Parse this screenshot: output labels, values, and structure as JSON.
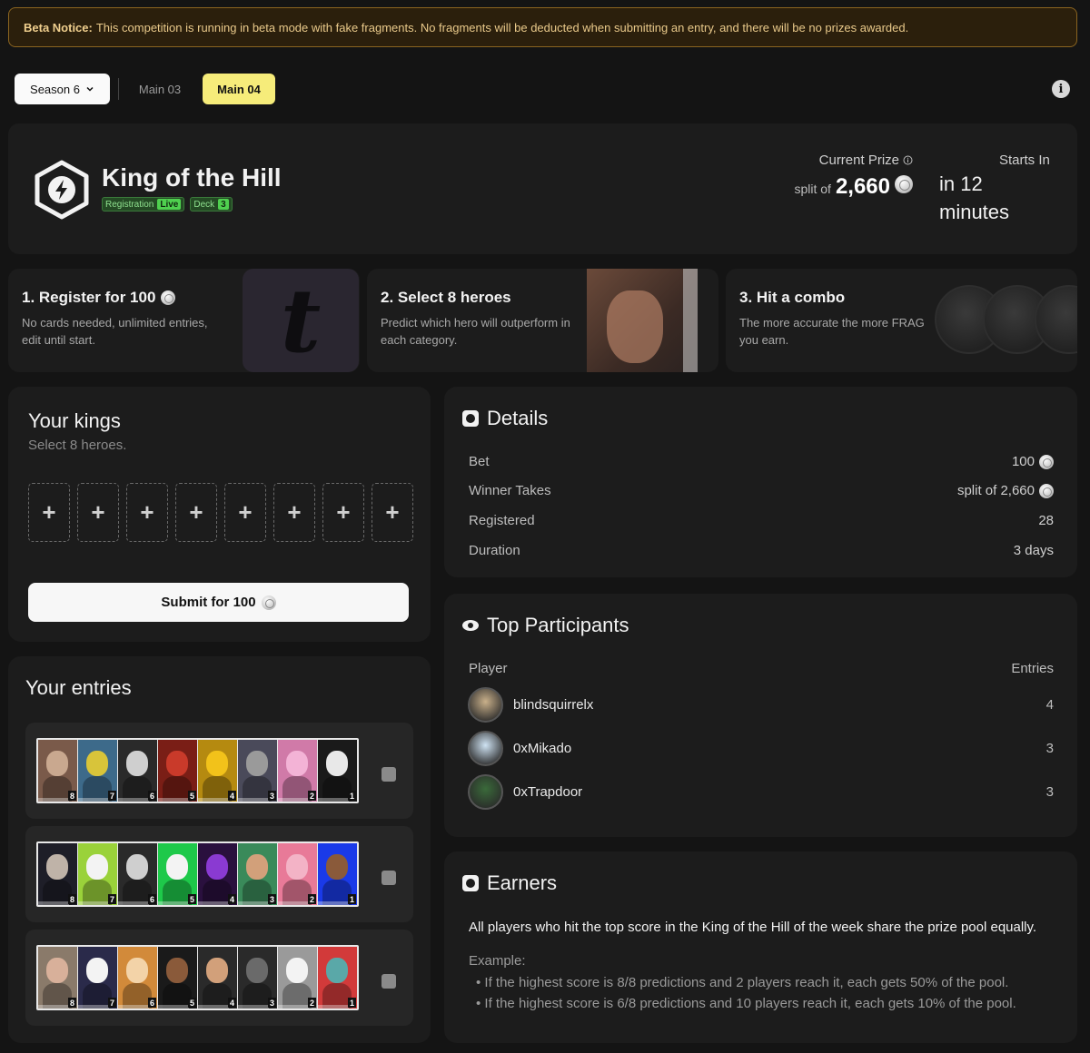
{
  "notice": {
    "label": "Beta Notice:",
    "text": "This competition is running in beta mode with fake fragments. No fragments will be deducted when submitting an entry, and there will be no prizes awarded."
  },
  "nav": {
    "season": "Season 6",
    "tabs": [
      "Main 03",
      "Main 04"
    ],
    "active_tab": "Main 04"
  },
  "hero": {
    "title": "King of the Hill",
    "tags": [
      {
        "label": "Registration",
        "pill": "Live"
      },
      {
        "label": "Deck",
        "pill": "3"
      }
    ],
    "prize_label": "Current Prize",
    "prize_prefix": "split of",
    "prize_value": "2,660",
    "starts_label": "Starts In",
    "starts_value": "in 12 minutes"
  },
  "steps": [
    {
      "title": "1. Register for 100",
      "desc": "No cards needed, unlimited entries, edit until start."
    },
    {
      "title": "2. Select 8 heroes",
      "desc": "Predict which hero will outperform in each category."
    },
    {
      "title": "3. Hit a combo",
      "desc": "The more accurate the more FRAG you earn."
    }
  ],
  "kings": {
    "title": "Your kings",
    "subtitle": "Select 8 heroes.",
    "slot_symbol": "+",
    "submit_label": "Submit for 100"
  },
  "entries": {
    "title": "Your entries",
    "rows": [
      {
        "cards": [
          {
            "n": "8",
            "c": "#c9a88f",
            "b": "#7a5a4a"
          },
          {
            "n": "7",
            "c": "#d8c43a",
            "b": "#3d6a8a"
          },
          {
            "n": "6",
            "c": "#cfcfcf",
            "b": "#2a2a2a"
          },
          {
            "n": "5",
            "c": "#c93a2a",
            "b": "#7a1e16"
          },
          {
            "n": "4",
            "c": "#f2c21a",
            "b": "#b58a10"
          },
          {
            "n": "3",
            "c": "#9a9a9a",
            "b": "#4a4a5a"
          },
          {
            "n": "2",
            "c": "#f3b3d6",
            "b": "#d07aa8"
          },
          {
            "n": "1",
            "c": "#e8e8e8",
            "b": "#1a1a1a"
          }
        ]
      },
      {
        "cards": [
          {
            "n": "8",
            "c": "#bfb3a8",
            "b": "#1e1e28"
          },
          {
            "n": "7",
            "c": "#f3f3f3",
            "b": "#9ad23a"
          },
          {
            "n": "6",
            "c": "#cfcfcf",
            "b": "#2a2a2a"
          },
          {
            "n": "5",
            "c": "#f3f3f3",
            "b": "#1ec94a"
          },
          {
            "n": "4",
            "c": "#8a3ad2",
            "b": "#2a103e"
          },
          {
            "n": "3",
            "c": "#d2a07a",
            "b": "#3a8a5a"
          },
          {
            "n": "2",
            "c": "#f3b3c6",
            "b": "#e87a98"
          },
          {
            "n": "1",
            "c": "#8a5a3a",
            "b": "#1a3ae8"
          }
        ]
      },
      {
        "cards": [
          {
            "n": "8",
            "c": "#d8b09a",
            "b": "#8a7a6a"
          },
          {
            "n": "7",
            "c": "#f3f3f3",
            "b": "#2a2a4a"
          },
          {
            "n": "6",
            "c": "#f3d3a8",
            "b": "#d28a3a"
          },
          {
            "n": "5",
            "c": "#8a5a3a",
            "b": "#1a1a1a"
          },
          {
            "n": "4",
            "c": "#d2a07a",
            "b": "#2a2a2a"
          },
          {
            "n": "3",
            "c": "#6a6a6a",
            "b": "#2a2a2a"
          },
          {
            "n": "2",
            "c": "#f3f3f3",
            "b": "#9a9a9a"
          },
          {
            "n": "1",
            "c": "#5aa8a8",
            "b": "#d23a3a"
          }
        ]
      }
    ]
  },
  "details": {
    "title": "Details",
    "rows": [
      {
        "label": "Bet",
        "value": "100",
        "coin": true
      },
      {
        "label": "Winner Takes",
        "value": "split of 2,660",
        "coin": true
      },
      {
        "label": "Registered",
        "value": "28",
        "coin": false
      },
      {
        "label": "Duration",
        "value": "3 days",
        "coin": false
      }
    ]
  },
  "top": {
    "title": "Top Participants",
    "col_player": "Player",
    "col_entries": "Entries",
    "players": [
      {
        "name": "blindsquirrelx",
        "entries": "4",
        "color": "#c9b08a"
      },
      {
        "name": "0xMikado",
        "entries": "3",
        "color": "#cfe3f3"
      },
      {
        "name": "0xTrapdoor",
        "entries": "3",
        "color": "#3a6a3a"
      }
    ]
  },
  "earners": {
    "title": "Earners",
    "lead": "All players who hit the top score in the King of the Hill of the week share the prize pool equally.",
    "example_label": "Example:",
    "bullets": [
      "• If the highest score is 8/8 predictions and 2 players reach it, each gets 50% of the pool.",
      "• If the highest score is 6/8 predictions and 10 players reach it, each gets 10% of the pool."
    ]
  }
}
